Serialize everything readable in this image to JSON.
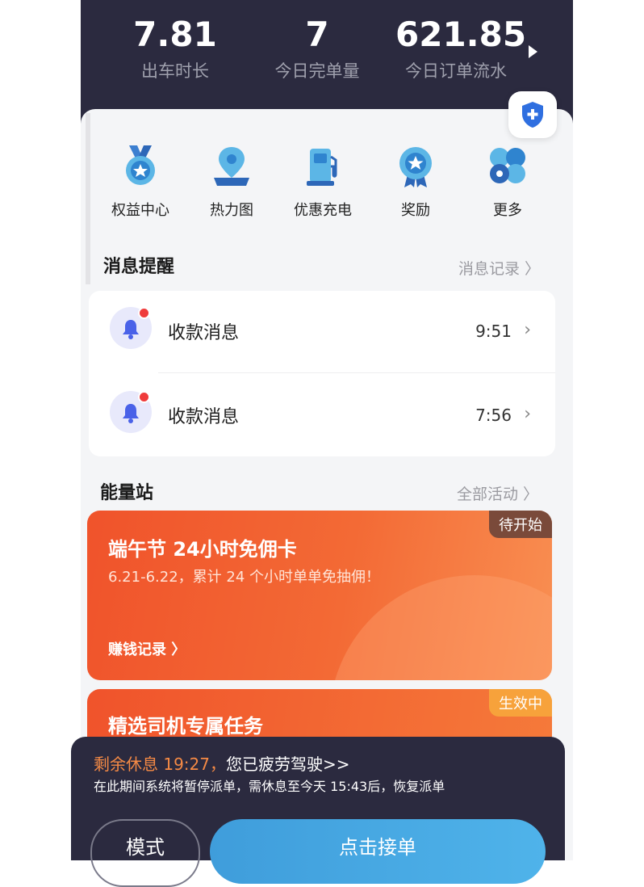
{
  "stats": [
    {
      "value": "7.81",
      "label": "出车时长"
    },
    {
      "value": "7",
      "label": "今日完单量"
    },
    {
      "value": "621.85",
      "label": "今日订单流水"
    }
  ],
  "quick_actions": [
    {
      "label": "权益中心",
      "icon": "medal-icon"
    },
    {
      "label": "热力图",
      "icon": "map-pin-icon"
    },
    {
      "label": "优惠充电",
      "icon": "charging-station-icon"
    },
    {
      "label": "奖励",
      "icon": "reward-badge-icon"
    },
    {
      "label": "更多",
      "icon": "more-apps-icon"
    }
  ],
  "messages": {
    "title": "消息提醒",
    "link": "消息记录 〉",
    "items": [
      {
        "title": "收款消息",
        "time": "9:51"
      },
      {
        "title": "收款消息",
        "time": "7:56"
      }
    ]
  },
  "energy": {
    "title": "能量站",
    "link": "全部活动 〉",
    "promos": [
      {
        "badge": "待开始",
        "title": "端午节 24小时免佣卡",
        "subtitle": "6.21-6.22，累计 24 个小时单单免抽佣！",
        "link": "赚钱记录 〉"
      },
      {
        "badge": "生效中",
        "title": "精选司机专属任务"
      }
    ]
  },
  "rest_notice": {
    "highlight": "剩余休息 19:27，",
    "text": "您已疲劳驾驶>>",
    "detail": "在此期间系统将暂停派单，需休息至今天 15:43后，恢复派单"
  },
  "buttons": {
    "mode": "模式",
    "accept": "点击接单"
  },
  "colors": {
    "dark": "#2b2a3f",
    "accent_orange": "#f0532b",
    "blue": "#4fb3ea",
    "alert_red": "#ef3b3b"
  }
}
